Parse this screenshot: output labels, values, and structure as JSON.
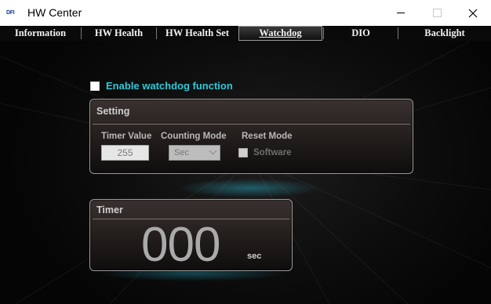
{
  "window": {
    "logo_text": "DFI",
    "title": "HW Center"
  },
  "tabs": [
    {
      "label": "Information",
      "active": false
    },
    {
      "label": "HW Health",
      "active": false
    },
    {
      "label": "HW Health Set",
      "active": false
    },
    {
      "label": "Watchdog",
      "active": true
    },
    {
      "label": "DIO",
      "active": false
    },
    {
      "label": "Backlight",
      "active": false
    }
  ],
  "watchdog": {
    "enable_label": "Enable watchdog function",
    "enable_checked": false
  },
  "setting": {
    "title": "Setting",
    "timer_value_label": "Timer Value",
    "counting_mode_label": "Counting Mode",
    "reset_mode_label": "Reset  Mode",
    "timer_value": "255",
    "counting_mode": "Sec",
    "software_label": "Software",
    "software_checked": false
  },
  "timer": {
    "title": "Timer",
    "count": "000",
    "unit": "sec"
  },
  "colors": {
    "accent": "#2ec8d8",
    "background": "#0d0d0d",
    "panel": "#2a2422"
  }
}
